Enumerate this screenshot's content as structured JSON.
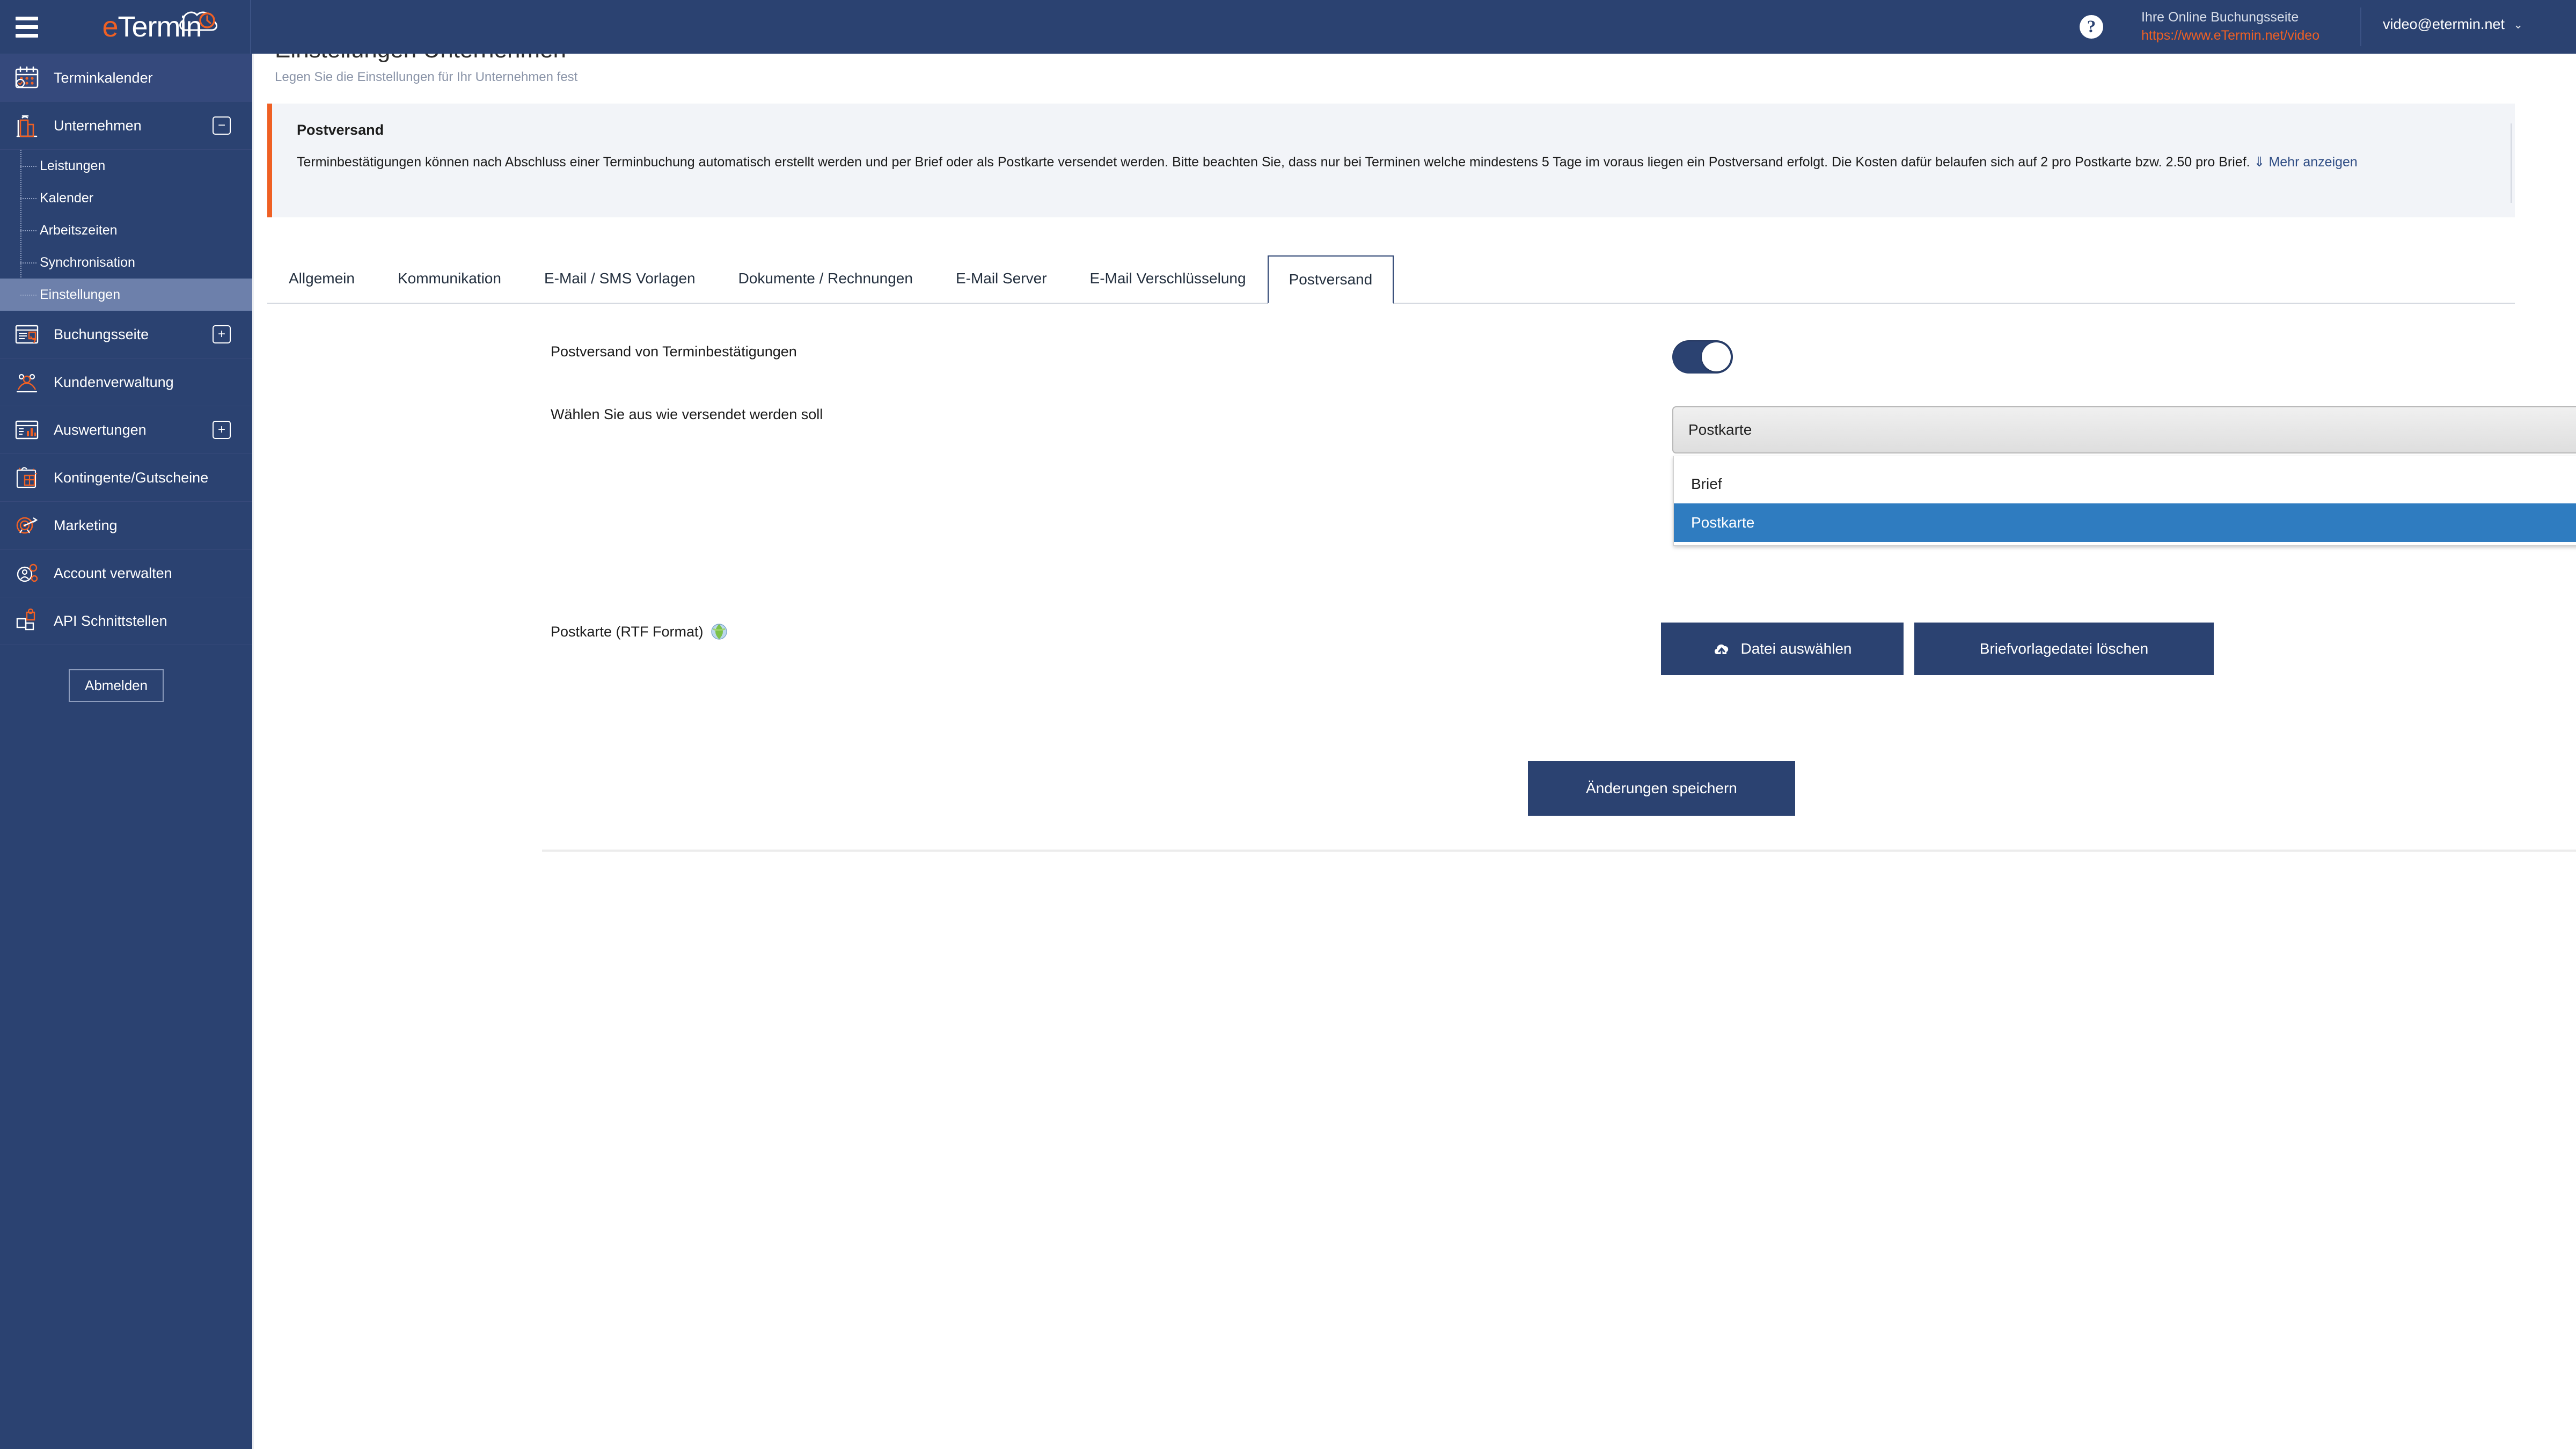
{
  "topbar": {
    "menu_icon": "hamburger-icon",
    "logo_text_accent": "e",
    "logo_text_rest": "Termin",
    "help_icon": "?",
    "booking_label": "Ihre Online Buchungsseite",
    "booking_url": "https://www.eTermin.net/video",
    "user_email": "video@etermin.net",
    "user_caret": "⌄",
    "accent_orange": "#ef6024",
    "brand_blue": "#2b4271"
  },
  "sidebar": {
    "items": [
      {
        "label": "Terminkalender",
        "icon": "calendar-icon",
        "toggle": "",
        "active": true
      },
      {
        "label": "Unternehmen",
        "icon": "building-icon",
        "toggle": "−",
        "active": false
      }
    ],
    "subitems": [
      {
        "label": "Leistungen",
        "selected": false
      },
      {
        "label": "Kalender",
        "selected": false
      },
      {
        "label": "Arbeitszeiten",
        "selected": false
      },
      {
        "label": "Synchronisation",
        "selected": false
      },
      {
        "label": "Einstellungen",
        "selected": true
      }
    ],
    "items2": [
      {
        "label": "Buchungsseite",
        "icon": "booking-page-icon",
        "toggle": "+"
      },
      {
        "label": "Kundenverwaltung",
        "icon": "customers-icon",
        "toggle": ""
      },
      {
        "label": "Auswertungen",
        "icon": "reports-icon",
        "toggle": "+"
      },
      {
        "label": "Kontingente/Gutscheine",
        "icon": "voucher-icon",
        "toggle": ""
      },
      {
        "label": "Marketing",
        "icon": "target-icon",
        "toggle": ""
      },
      {
        "label": "Account verwalten",
        "icon": "account-gear-icon",
        "toggle": ""
      },
      {
        "label": "API Schnittstellen",
        "icon": "puzzle-icon",
        "toggle": ""
      }
    ],
    "logout_label": "Abmelden"
  },
  "page": {
    "title": "Einstellungen Unternehmen",
    "subtitle": "Legen Sie die Einstellungen für Ihr Unternehmen fest"
  },
  "alert": {
    "title": "Postversand",
    "body": "Terminbestätigungen können nach Abschluss einer Terminbuchung automatisch erstellt werden und per Brief oder als Postkarte versendet werden. Bitte beachten Sie, dass nur bei Terminen welche mindestens 5 Tage im voraus liegen ein Postversand erfolgt. Die Kosten dafür belaufen sich auf 2 pro Postkarte bzw. 2.50 pro Brief.",
    "more_label": "Mehr anzeigen",
    "more_icon": "»",
    "border_color": "#ef6024"
  },
  "tabs": [
    {
      "label": "Allgemein",
      "active": false
    },
    {
      "label": "Kommunikation",
      "active": false
    },
    {
      "label": "E-Mail / SMS Vorlagen",
      "active": false
    },
    {
      "label": "Dokumente / Rechnungen",
      "active": false
    },
    {
      "label": "E-Mail Server",
      "active": false
    },
    {
      "label": "E-Mail Verschlüsselung",
      "active": false
    },
    {
      "label": "Postversand",
      "active": true
    }
  ],
  "form": {
    "toggle_label": "Postversand von Terminbestätigungen",
    "toggle_state": "on",
    "select_label": "Wählen Sie aus wie versendet werden soll",
    "select_value": "Postkarte",
    "select_caret": "▼",
    "select_options": [
      {
        "label": "Brief",
        "selected": false
      },
      {
        "label": "Postkarte",
        "selected": true
      }
    ],
    "file_label": "Postkarte (RTF Format)",
    "file_label_icon": "globe-icon",
    "file_button": "Datei auswählen",
    "file_button_icon": "upload-cloud-icon",
    "delete_button": "Briefvorlagedatei löschen",
    "save_button": "Änderungen speichern"
  }
}
